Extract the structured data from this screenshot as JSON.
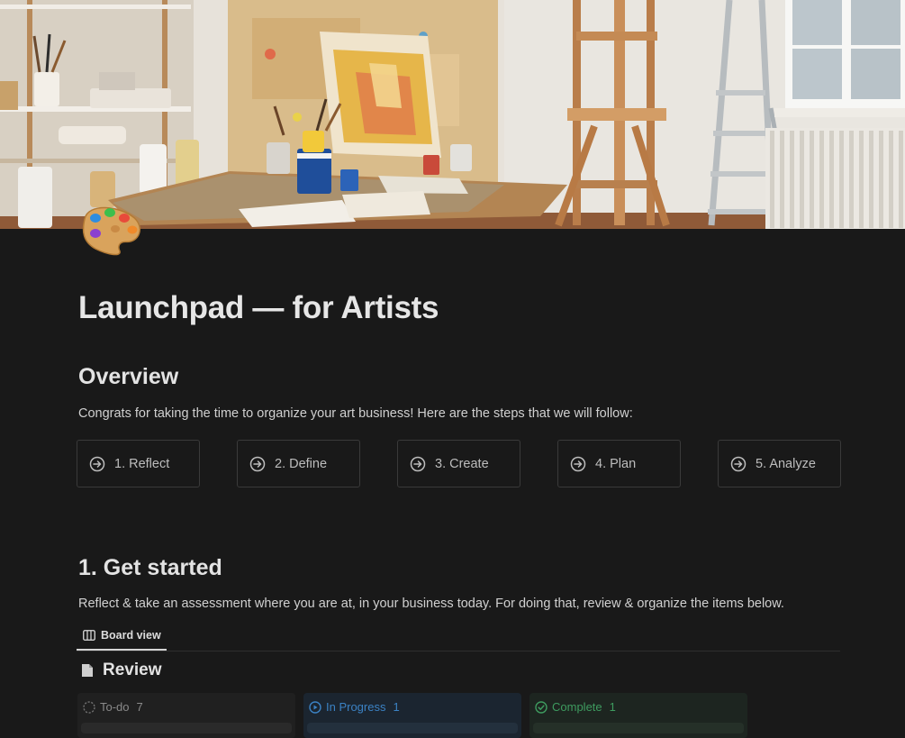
{
  "page": {
    "icon_name": "artist-palette-icon",
    "title": "Launchpad — for Artists"
  },
  "overview": {
    "heading": "Overview",
    "text": "Congrats for taking the time to organize your art business! Here are the steps that we will follow:",
    "steps": [
      {
        "label": "1. Reflect",
        "icon": "arrow-circle-right-icon"
      },
      {
        "label": "2. Define",
        "icon": "arrow-circle-right-icon"
      },
      {
        "label": "3. Create",
        "icon": "arrow-circle-right-icon"
      },
      {
        "label": "4. Plan",
        "icon": "arrow-circle-right-icon"
      },
      {
        "label": "5. Analyze",
        "icon": "arrow-circle-right-icon"
      }
    ]
  },
  "get_started": {
    "heading": "1. Get started",
    "text": "Reflect & take an assessment where you are at, in your business today. For doing that, review & organize the items below.",
    "view_tab": {
      "label": "Board view",
      "icon": "board-view-icon"
    },
    "database": {
      "title": "Review",
      "icon": "page-icon"
    },
    "columns": [
      {
        "label": "To-do",
        "count": "7",
        "icon": "status-todo-icon",
        "color": "#8a8a8a"
      },
      {
        "label": "In Progress",
        "count": "1",
        "icon": "status-in-progress-icon",
        "color": "#3b82c4"
      },
      {
        "label": "Complete",
        "count": "1",
        "icon": "status-complete-icon",
        "color": "#3e9b5f"
      }
    ]
  },
  "colors": {
    "background": "#191919",
    "border": "#3a3a3a",
    "text_primary": "#e3e3e3",
    "text_secondary": "#bdbdbd"
  }
}
